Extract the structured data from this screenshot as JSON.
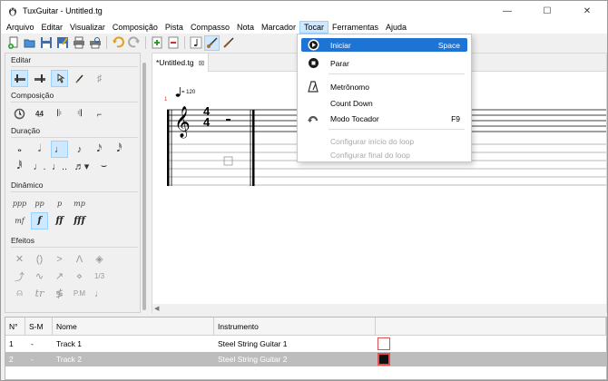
{
  "window": {
    "title": "TuxGuitar - Untitled.tg"
  },
  "menubar": [
    "Arquivo",
    "Editar",
    "Visualizar",
    "Composição",
    "Pista",
    "Compasso",
    "Nota",
    "Marcador",
    "Tocar",
    "Ferramentas",
    "Ajuda"
  ],
  "tab": {
    "label": "*Untitled.tg",
    "close": "⊠"
  },
  "left_panel": {
    "editar": "Editar",
    "composicao": "Composição",
    "duracao": "Duração",
    "dinamico": "Dinâmico",
    "efeitos": "Efeitos",
    "dynamics": [
      "ppp",
      "pp",
      "p",
      "mp",
      "mf",
      "f",
      "ff",
      "fff"
    ]
  },
  "score": {
    "measure_number": "1",
    "tempo": "= 120",
    "time_top": "4",
    "time_bottom": "4"
  },
  "tracks": {
    "headers": [
      "N°",
      "S-M",
      "Nome",
      "Instrumento"
    ],
    "rows": [
      {
        "num": "1",
        "sm": "-",
        "name": "Track 1",
        "instrument": "Steel String Guitar 1"
      },
      {
        "num": "2",
        "sm": "-",
        "name": "Track 2",
        "instrument": "Steel String Guitar 2"
      }
    ]
  },
  "tocar_menu": {
    "iniciar": "Iniciar",
    "iniciar_acc": "Space",
    "parar": "Parar",
    "metronomo": "Metrônomo",
    "count_down": "Count Down",
    "modo_tocador": "Modo Tocador",
    "modo_tocador_acc": "F9",
    "config_inicio": "Configurar início do loop",
    "config_final": "Configurar final do loop"
  },
  "colors": {
    "highlight": "#1e74d4",
    "selected_row": "#bdbdbd",
    "track_marker": "#e05050"
  }
}
